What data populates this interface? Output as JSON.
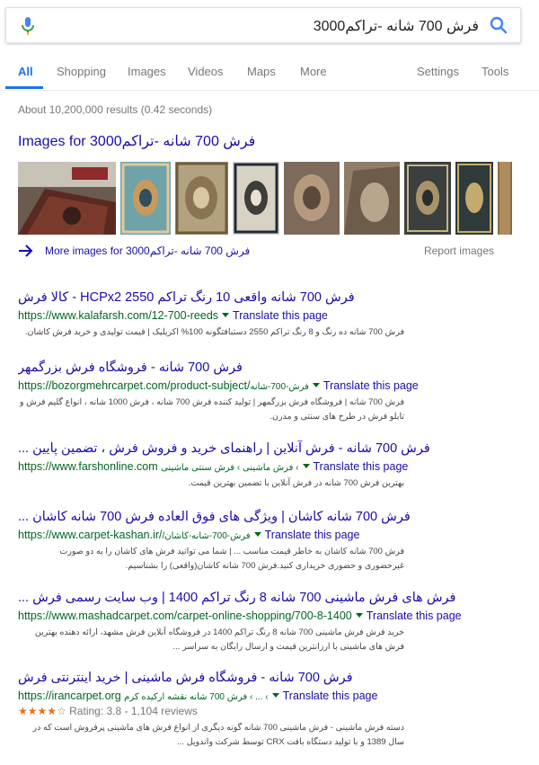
{
  "search": {
    "query": "فرش 700 شانه -تراکم3000"
  },
  "tabs": [
    {
      "label": "All",
      "active": true
    },
    {
      "label": "Shopping"
    },
    {
      "label": "Images"
    },
    {
      "label": "Videos"
    },
    {
      "label": "Maps"
    },
    {
      "label": "More"
    },
    {
      "label": "Settings"
    },
    {
      "label": "Tools"
    }
  ],
  "stats": "About 10,200,000 results (0.42 seconds)",
  "images_block": {
    "heading": "Images for فرش 700 شانه -تراکم3000",
    "more_label": "More images for فرش 700 شانه -تراکم3000",
    "report_label": "Report images",
    "thumb_count": 9
  },
  "results": [
    {
      "title": "فرش 700 شانه واقعی 10 رنگ تراکم 2550 HCPx2 - کالا فرش",
      "url": "https://www.kalafarsh.com/12-700-reeds",
      "crumb": "",
      "translate": "Translate this page",
      "snippet": "فرش 700 شانه ده رنگ و 8 رنگ تراکم 2550 دستبافتگونه 100% اکریلیک | قیمت تولیدی و خرید فرش کاشان."
    },
    {
      "title": "فرش 700 شانه - فروشگاه فرش بزرگمهر",
      "url": "https://bozorgmehrcarpet.com/product-subject/",
      "crumb": "فرش-700-شانه",
      "translate": "Translate this page",
      "snippet": "فرش 700 شانه | فروشگاه فرش بزرگمهر | تولید کننده فرش 700 شانه ، فرش 1000 شانه ، انواع گلیم فرش و تابلو فرش در طرح های سنتی و مدرن."
    },
    {
      "title": "فرش 700 شانه - فرش آنلاین | راهنمای خرید و فروش فرش ، تضمین پایین ...",
      "url": "https://www.farshonline.com",
      "crumb": "› فرش ماشینی › فرش سنتی ماشینی",
      "translate": "Translate this page",
      "snippet": "بهترین فرش 700 شانه در فرش آنلاین با تضمین بهترین قیمت."
    },
    {
      "title": "فرش 700 شانه کاشان | ویژگی های فوق العاده فرش 700 شانه کاشان ...",
      "url": "https://www.carpet-kashan.ir/",
      "crumb": "فرش-700-شانه-کاشان/",
      "translate": "Translate this page",
      "snippet": "فرش 700 شانه کاشان به خاطر قیمت مناسب ... | شما می توانید فرش های کاشان را به دو صورت غیرحضوری و حضوری خریداری کنید.فرش 700 شانه کاشان(واقعی) را بشناسیم."
    },
    {
      "title": "فرش های فرش ماشینی 700 شانه 8 رنگ تراکم 1400 | وب سایت رسمی فرش ...",
      "url": "https://www.mashadcarpet.com/carpet-online-shopping/700-8-1400",
      "crumb": "",
      "translate": "Translate this page",
      "snippet": "خرید فرش فرش ماشینی 700 شانه 8 رنگ تراکم 1400 در فروشگاه آنلاین فرش مشهد، ارائه دهنده بهترین فرش های ماشینی با ارزانترین قیمت و ارسال رایگان به سراسر ..."
    },
    {
      "title": "فرش 700 شانه - فروشگاه فرش ماشینی | خرید اینترنتی فرش",
      "url": "https://irancarpet.org",
      "crumb": "› ... › فرش 700 شانه نقشه ارکیده کرم",
      "translate": "Translate this page",
      "rating_stars": "★★★★☆",
      "rating_text": "Rating: 3.8 - 1,104 reviews",
      "snippet": "دسته فرش ماشینی - فرش ماشینی 700 شانه گونه دیگری از انواع فرش های ماشینی پرفروش است که در سال 1389 و با تولید دستگاه بافت CRX توسط شرکت واندویل ..."
    }
  ],
  "colors": {
    "link": "#1a0dab",
    "url_green": "#006621",
    "active_tab": "#1a73e8",
    "star": "#e7711b"
  },
  "icons": [
    "microphone-icon",
    "search-icon",
    "arrow-right-icon"
  ]
}
